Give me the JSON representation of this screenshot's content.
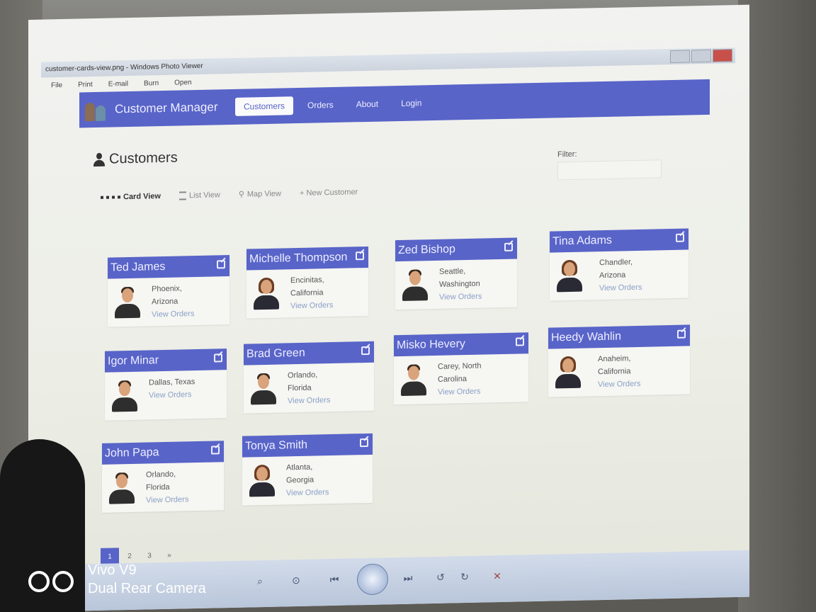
{
  "window": {
    "title": "customer-cards-view.png - Windows Photo Viewer",
    "menu": [
      "File",
      "Print",
      "E-mail",
      "Burn",
      "Open"
    ]
  },
  "app": {
    "brand": "Customer Manager",
    "nav": [
      "Customers",
      "Orders",
      "About",
      "Login"
    ],
    "active_nav": "Customers"
  },
  "page": {
    "title": "Customers",
    "filter_label": "Filter:",
    "toolbar": [
      "Card View",
      "List View",
      "Map View",
      "+ New Customer"
    ]
  },
  "cards": [
    {
      "name": "Ted James",
      "city": "Phoenix,",
      "state": "Arizona",
      "link": "View Orders",
      "gender": "male"
    },
    {
      "name": "Michelle Thompson",
      "city": "Encinitas,",
      "state": "California",
      "link": "View Orders",
      "gender": "female"
    },
    {
      "name": "Zed Bishop",
      "city": "Seattle,",
      "state": "Washington",
      "link": "View Orders",
      "gender": "male"
    },
    {
      "name": "Tina Adams",
      "city": "Chandler,",
      "state": "Arizona",
      "link": "View Orders",
      "gender": "female"
    },
    {
      "name": "Igor Minar",
      "city": "Dallas, Texas",
      "state": "",
      "link": "View Orders",
      "gender": "male"
    },
    {
      "name": "Brad Green",
      "city": "Orlando,",
      "state": "Florida",
      "link": "View Orders",
      "gender": "male"
    },
    {
      "name": "Misko Hevery",
      "city": "Carey, North",
      "state": "Carolina",
      "link": "View Orders",
      "gender": "male"
    },
    {
      "name": "Heedy Wahlin",
      "city": "Anaheim,",
      "state": "California",
      "link": "View Orders",
      "gender": "female"
    },
    {
      "name": "John Papa",
      "city": "Orlando,",
      "state": "Florida",
      "link": "View Orders",
      "gender": "male"
    },
    {
      "name": "Tonya Smith",
      "city": "Atlanta,",
      "state": "Georgia",
      "link": "View Orders",
      "gender": "female"
    }
  ],
  "pager": [
    "1",
    "2",
    "3",
    "»"
  ],
  "watermark": {
    "line1": "Vivo V9",
    "line2": "Dual Rear Camera"
  },
  "colors": {
    "navbar": "#5864c8",
    "card_header": "#5864c8"
  }
}
